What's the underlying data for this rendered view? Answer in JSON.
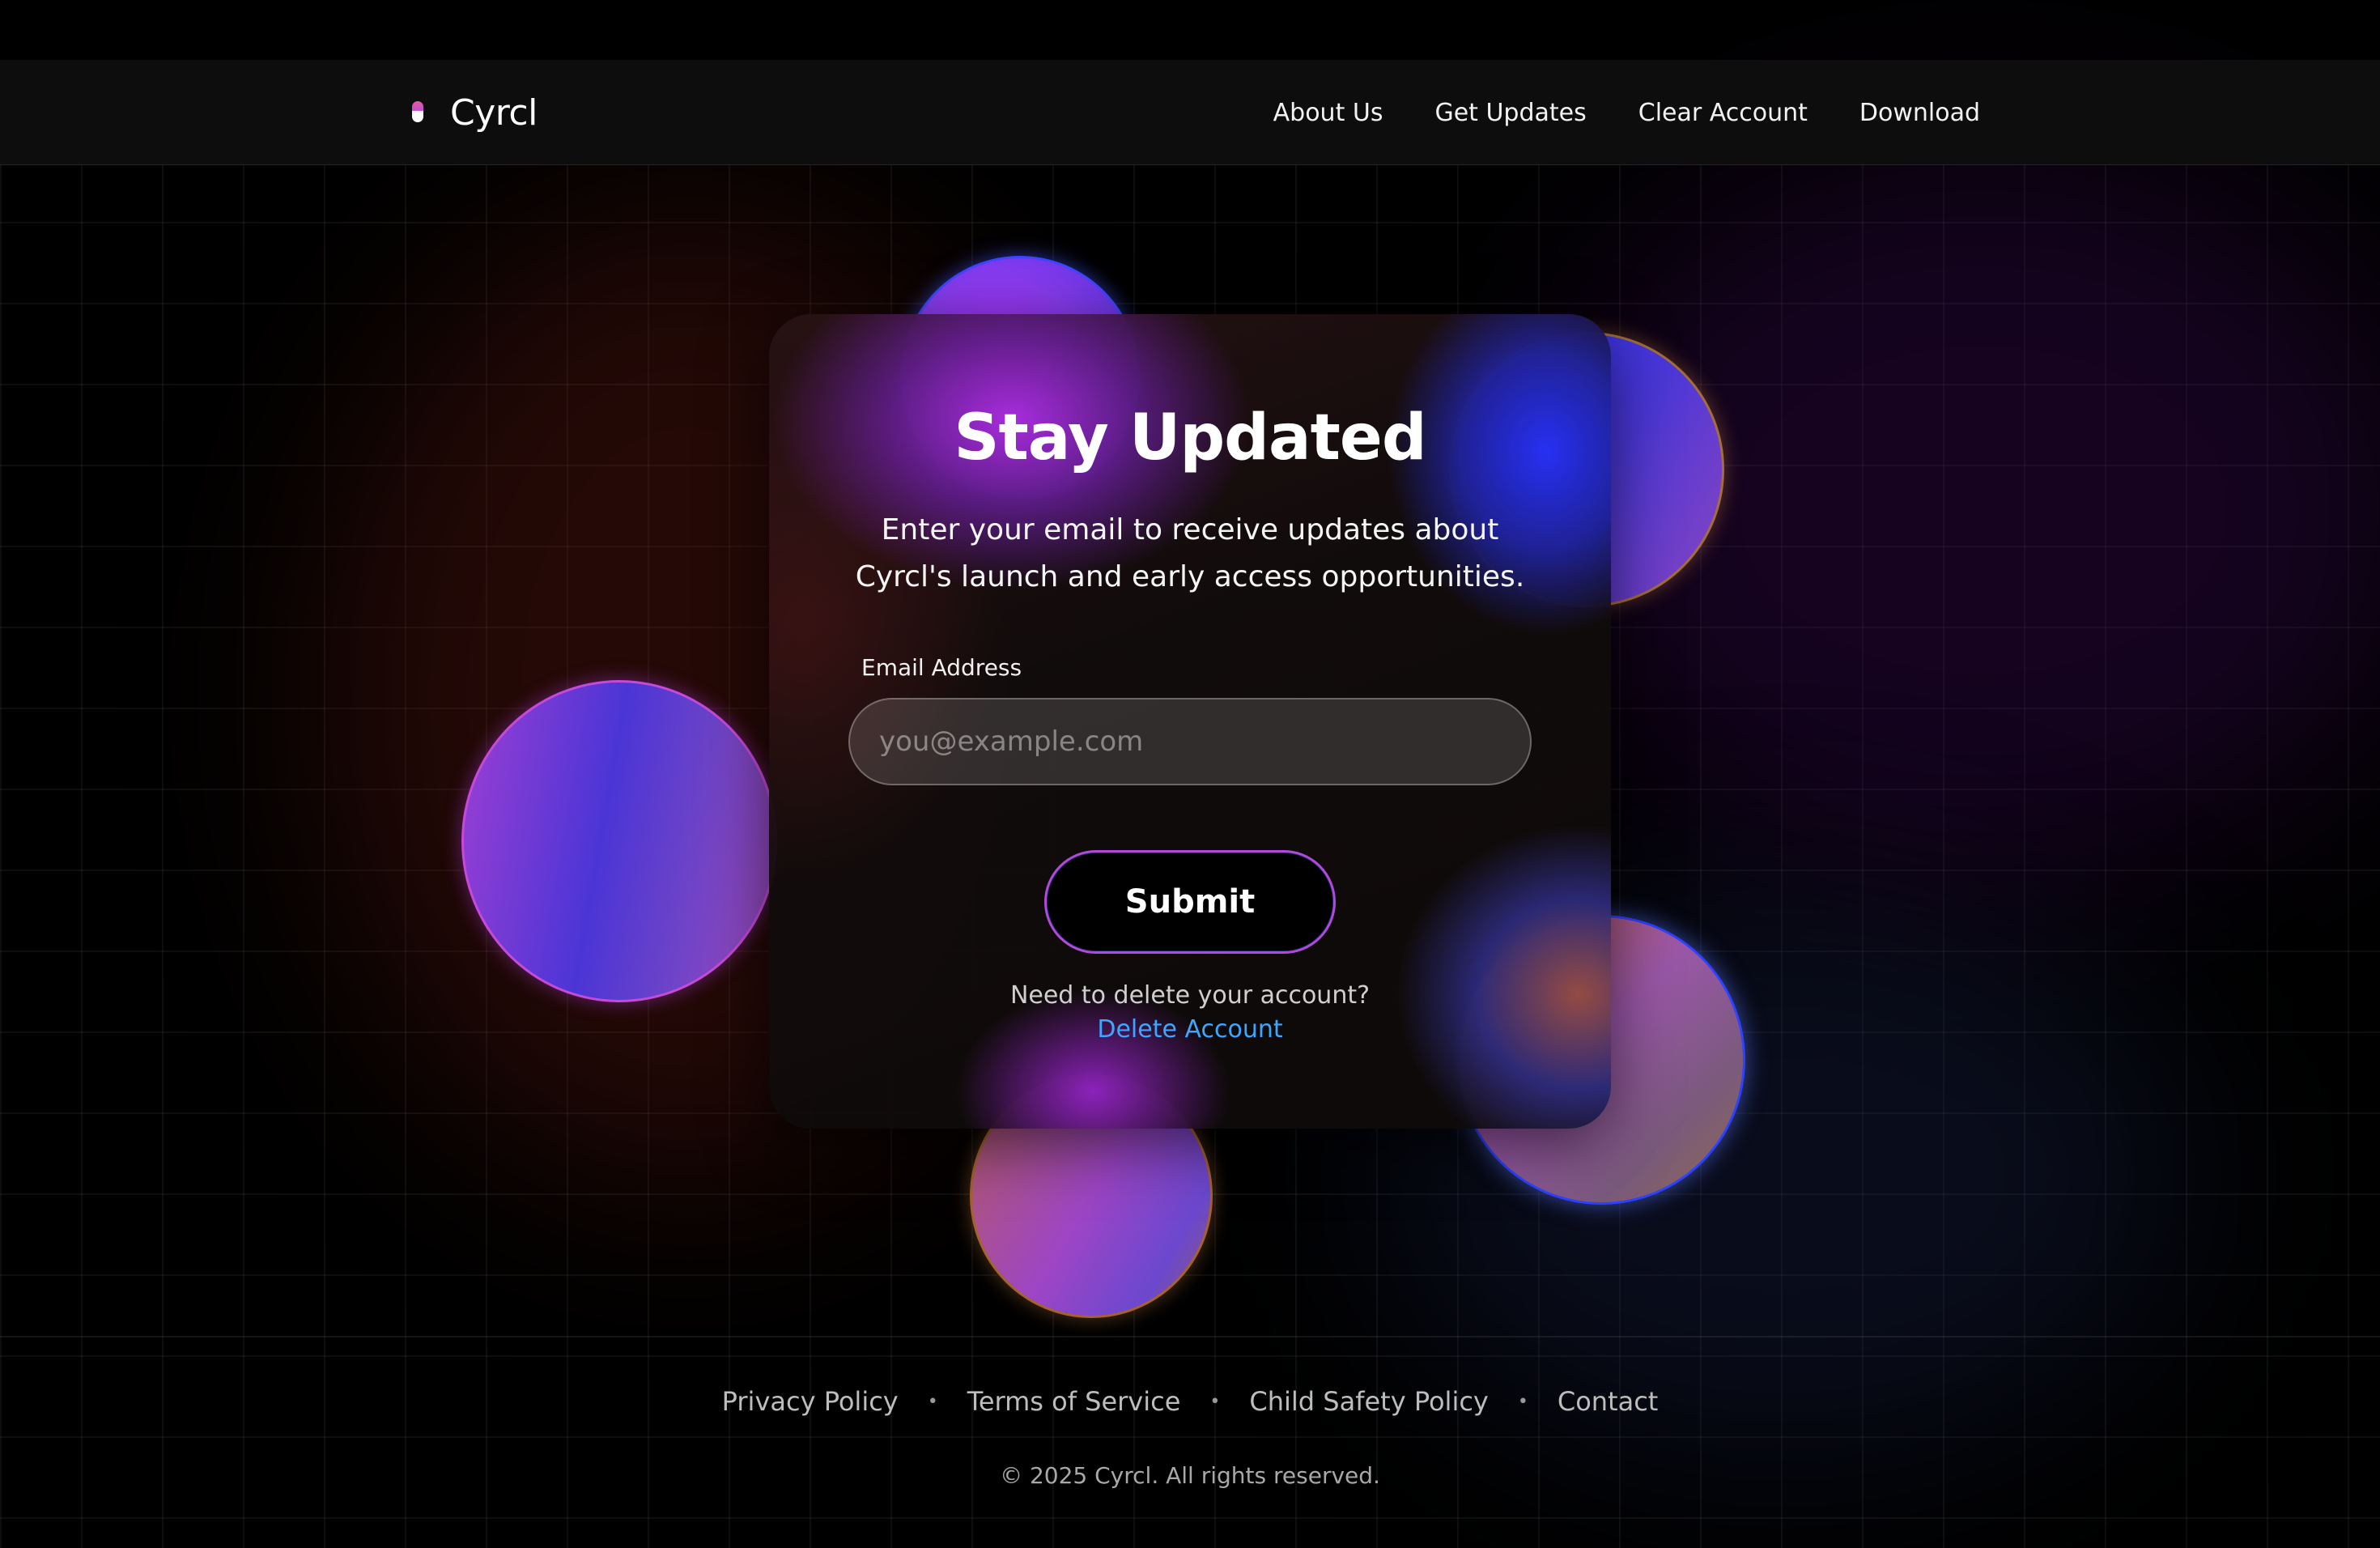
{
  "nav": {
    "brand": "Cyrcl",
    "links": [
      "About Us",
      "Get Updates",
      "Clear Account",
      "Download"
    ]
  },
  "card": {
    "title": "Stay Updated",
    "description_line1": "Enter your email to receive updates about",
    "description_line2": "Cyrcl's launch and early access opportunities.",
    "email_label": "Email Address",
    "email_placeholder": "you@example.com",
    "email_value": "",
    "submit_label": "Submit",
    "delete_prompt": "Need to delete your account?",
    "delete_link": "Delete Account"
  },
  "footer": {
    "links": [
      "Privacy Policy",
      "Terms of Service",
      "Child Safety Policy",
      "Contact"
    ],
    "separator": "•",
    "copyright": "© 2025 Cyrcl. All rights reserved."
  },
  "colors": {
    "background": "#000000",
    "navbar": "#0d0d0d",
    "link_accent": "#3ea6ff",
    "button_border": "#b04ad8",
    "orb_purple": "#9c3fd3",
    "orb_blue": "#2530ff"
  },
  "icons": {
    "brand_logo": "pill-logo-icon"
  }
}
